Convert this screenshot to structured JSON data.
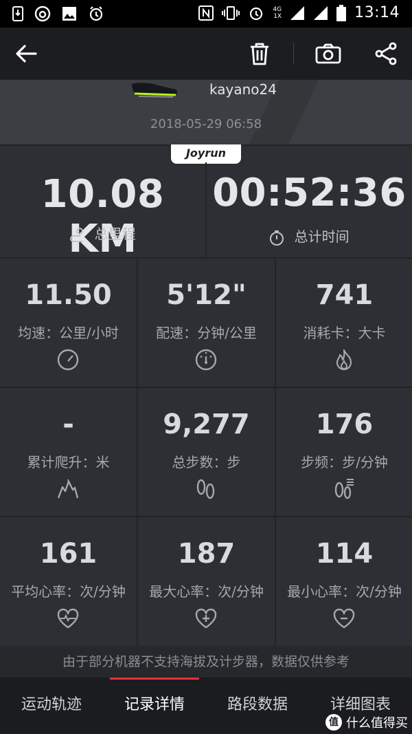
{
  "status_bar": {
    "time": "13:14",
    "network": [
      "4G",
      "1X"
    ]
  },
  "toolbar": {
    "icons": [
      "back-arrow-icon",
      "trash-icon",
      "camera-icon",
      "share-icon"
    ]
  },
  "run": {
    "shoe_name": "kayano24",
    "date": "2018-05-29 06:58",
    "brand_badge": "Joyrun"
  },
  "summary": {
    "distance": {
      "value": "10.08 KM",
      "label": "总里程"
    },
    "duration": {
      "value": "00:52:36",
      "label": "总计时间"
    }
  },
  "stats": [
    {
      "value": "11.50",
      "label": "均速：公里/小时",
      "icon": "speedometer-icon"
    },
    {
      "value": "5'12\"",
      "label": "配速：分钟/公里",
      "icon": "pace-gauge-icon"
    },
    {
      "value": "741",
      "label": "消耗卡：大卡",
      "icon": "flame-icon"
    },
    {
      "value": "-",
      "label": "累计爬升：米",
      "icon": "mountain-icon"
    },
    {
      "value": "9,277",
      "label": "总步数：步",
      "icon": "footprints-icon"
    },
    {
      "value": "176",
      "label": "步频：步/分钟",
      "icon": "cadence-icon"
    },
    {
      "value": "161",
      "label": "平均心率：次/分钟",
      "icon": "heart-rate-icon"
    },
    {
      "value": "187",
      "label": "最大心率：次/分钟",
      "icon": "heart-plus-icon"
    },
    {
      "value": "114",
      "label": "最小心率：次/分钟",
      "icon": "heart-minus-icon"
    }
  ],
  "note": "由于部分机器不支持海拔及计步器，数据仅供参考",
  "tabs": [
    {
      "label": "运动轨迹",
      "active": false
    },
    {
      "label": "记录详情",
      "active": true
    },
    {
      "label": "路段数据",
      "active": false
    },
    {
      "label": "详细图表",
      "active": false
    }
  ],
  "watermark": {
    "badge": "值",
    "text": "什么值得买"
  },
  "colors": {
    "accent": "#e5323a",
    "background": "#2c2f33",
    "toolbar": "#1c1d20"
  }
}
